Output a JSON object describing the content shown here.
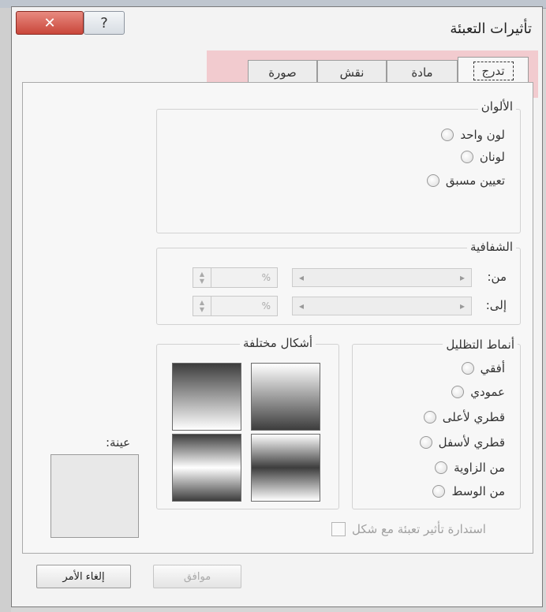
{
  "window": {
    "title": "تأثيرات التعبئة",
    "close_glyph": "✕",
    "help_glyph": "?"
  },
  "tabs": [
    {
      "label": "تدرج",
      "active": true
    },
    {
      "label": "مادة",
      "active": false
    },
    {
      "label": "نقش",
      "active": false
    },
    {
      "label": "صورة",
      "active": false
    }
  ],
  "colors_group": {
    "label": "الألوان",
    "options": [
      "لون واحد",
      "لونان",
      "تعيين مسبق"
    ]
  },
  "transparency_group": {
    "label": "الشفافية",
    "from_label": "من:",
    "to_label": "إلى:",
    "from_value": "%",
    "to_value": "%"
  },
  "shading_group": {
    "label": "أنماط التظليل",
    "options": [
      "أفقي",
      "عمودي",
      "قطري لأعلى",
      "قطري لأسفل",
      "من الزاوية",
      "من الوسط"
    ]
  },
  "variants_group": {
    "label": "أشكال مختلفة"
  },
  "sample": {
    "label": "عينة:"
  },
  "rotate_checkbox": {
    "label": "استدارة تأثير تعبئة مع شكل",
    "checked": false
  },
  "buttons": {
    "ok": "موافق",
    "cancel": "إلغاء الأمر"
  },
  "highlight_color": "#f2c7cb"
}
